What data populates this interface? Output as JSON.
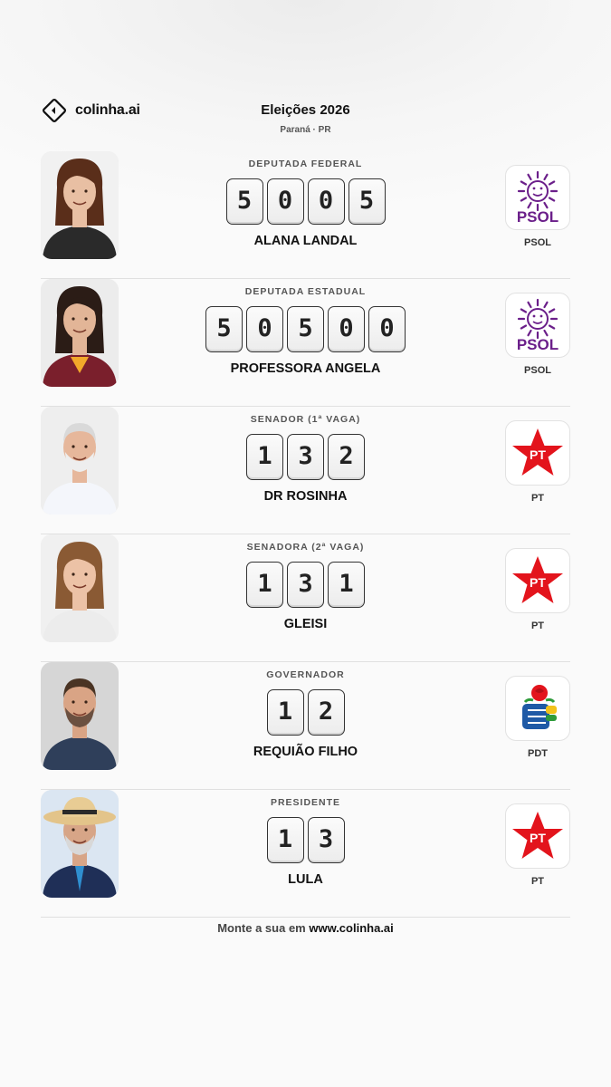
{
  "brand": {
    "name": "colinha.ai",
    "icon": "colinha-diamond-logo"
  },
  "header": {
    "title": "Eleições 2026",
    "subtitle": "Paraná · PR"
  },
  "candidates": [
    {
      "role": "DEPUTADA FEDERAL",
      "number": "5005",
      "name": "ALANA LANDAL",
      "party": "PSOL",
      "party_logo": "psol-sun-logo",
      "party_color": "#6b1f8a"
    },
    {
      "role": "DEPUTADA ESTADUAL",
      "number": "50500",
      "name": "PROFESSORA ANGELA",
      "party": "PSOL",
      "party_logo": "psol-sun-logo",
      "party_color": "#6b1f8a"
    },
    {
      "role": "SENADOR (1ª VAGA)",
      "number": "132",
      "name": "DR ROSINHA",
      "party": "PT",
      "party_logo": "pt-star-logo",
      "party_color": "#e3141c"
    },
    {
      "role": "SENADORA (2ª VAGA)",
      "number": "131",
      "name": "GLEISI",
      "party": "PT",
      "party_logo": "pt-star-logo",
      "party_color": "#e3141c"
    },
    {
      "role": "GOVERNADOR",
      "number": "12",
      "name": "REQUIÃO FILHO",
      "party": "PDT",
      "party_logo": "pdt-rose-fist-logo",
      "party_color": "#1f5aa6"
    },
    {
      "role": "PRESIDENTE",
      "number": "13",
      "name": "LULA",
      "party": "PT",
      "party_logo": "pt-star-logo",
      "party_color": "#e3141c"
    }
  ],
  "footer": {
    "prefix": "Monte a sua em ",
    "link": "www.colinha.ai"
  }
}
